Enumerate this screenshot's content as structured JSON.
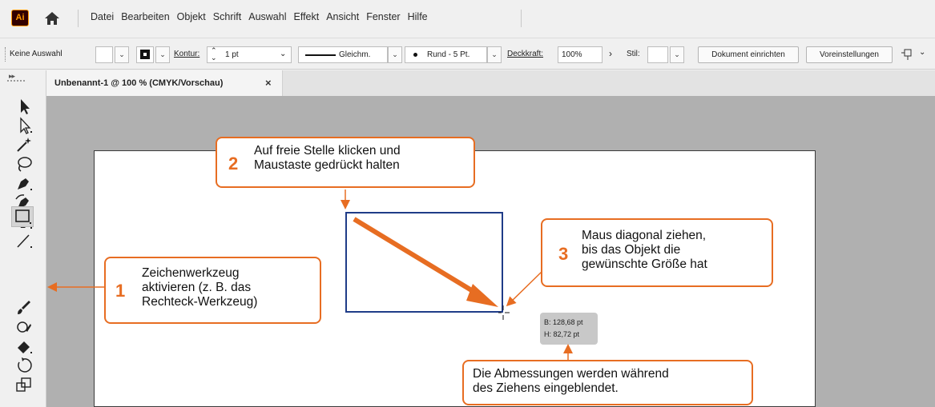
{
  "app": {
    "logo": "Ai",
    "menu": [
      "Datei",
      "Bearbeiten",
      "Objekt",
      "Schrift",
      "Auswahl",
      "Effekt",
      "Ansicht",
      "Fenster",
      "Hilfe"
    ]
  },
  "control_bar": {
    "selection": "Keine Auswahl",
    "stroke_label": "Kontur:",
    "stroke_value": "1 pt",
    "stroke_profile": "Gleichm.",
    "brush": "Rund - 5 Pt.",
    "opacity_label": "Deckkraft:",
    "opacity_value": "100%",
    "style_label": "Stil:",
    "doc_setup_button": "Dokument einrichten",
    "prefs_button": "Voreinstellungen"
  },
  "document": {
    "tab_title": "Unbenannt-1 @ 100 % (CMYK/Vorschau)",
    "close": "×"
  },
  "tools": [
    "selection-tool",
    "direct-selection-tool",
    "magic-wand-tool",
    "lasso-tool",
    "pen-tool",
    "curvature-tool",
    "type-tool",
    "line-tool",
    "rectangle-tool",
    "paintbrush-tool",
    "shaper-tool",
    "eraser-tool",
    "rotate-tool",
    "scale-tool"
  ],
  "active_tool": "rectangle-tool",
  "tooltip": {
    "width": "B: 128,68 pt",
    "height": "H: 82,72 pt"
  },
  "callouts": [
    {
      "num": "1",
      "text": "Zeichenwerkzeug\naktivieren (z. B. das\nRechteck-Werkzeug)"
    },
    {
      "num": "2",
      "text": "Auf freie Stelle klicken und\nMaustaste gedrückt halten"
    },
    {
      "num": "3",
      "text": "Maus diagonal ziehen,\nbis das Objekt die\ngewünschte Größe hat"
    },
    {
      "num": "",
      "text": "Die Abmessungen werden während\ndes Ziehens eingeblendet."
    }
  ],
  "colors": {
    "accent": "#e76d22",
    "shape_stroke": "#1f3c88",
    "canvas": "#b0b0b0"
  }
}
